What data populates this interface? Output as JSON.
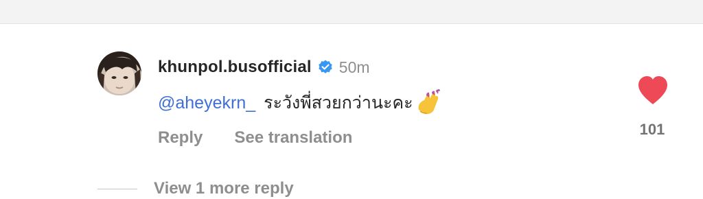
{
  "comment": {
    "username": "khunpol.busofficial",
    "timestamp": "50m",
    "mention": "@aheyekrn_",
    "text": "ระวังพี่สวยกว่านะคะ",
    "emoji": "nail-polish",
    "reply_label": "Reply",
    "see_translation_label": "See translation",
    "like_count": "101",
    "liked": true,
    "view_replies_label": "View 1 more reply"
  },
  "icons": {
    "verified": "verified-badge-icon",
    "like": "heart-icon"
  },
  "colors": {
    "verified_blue": "#3897f0",
    "mention_blue": "#3f6fd6",
    "heart_red": "#ed4956",
    "text_primary": "#262626",
    "text_secondary": "#8e8e8e"
  }
}
